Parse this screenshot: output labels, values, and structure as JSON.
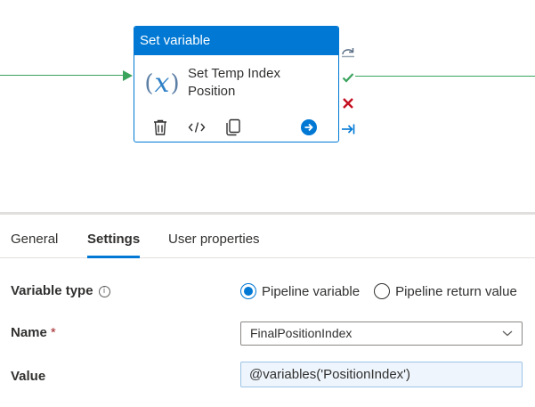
{
  "activity": {
    "type_label": "Set variable",
    "name_line1": "Set Temp Index",
    "name_line2": "Position",
    "icon": "variable-icon"
  },
  "activity_tools": [
    "delete-icon",
    "code-icon",
    "copy-icon",
    "run-arrow-icon"
  ],
  "side_outputs": [
    "skip-icon",
    "success-icon",
    "failure-icon",
    "completion-icon"
  ],
  "tabs": [
    {
      "label": "General",
      "active": false
    },
    {
      "label": "Settings",
      "active": true
    },
    {
      "label": "User properties",
      "active": false
    }
  ],
  "form": {
    "variable_type": {
      "label": "Variable type",
      "info": "ⓘ",
      "options": [
        {
          "label": "Pipeline variable",
          "checked": true
        },
        {
          "label": "Pipeline return value",
          "checked": false
        }
      ]
    },
    "name": {
      "label": "Name",
      "required_mark": "*",
      "value": "FinalPositionIndex"
    },
    "value": {
      "label": "Value",
      "value": "@variables('PositionIndex')"
    }
  },
  "colors": {
    "accent": "#0078d4",
    "connector": "#3aa35c",
    "failure": "#c50f1f"
  }
}
